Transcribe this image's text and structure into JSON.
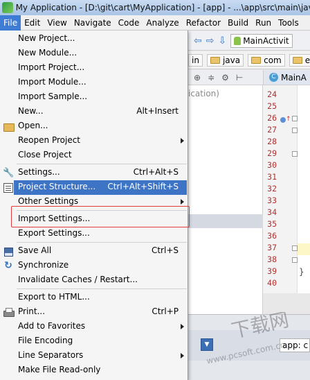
{
  "window": {
    "title": "My Application - [D:\\git\\cart\\MyApplication] - [app] - ...\\app\\src\\main\\java"
  },
  "menubar": {
    "items": [
      "File",
      "Edit",
      "View",
      "Navigate",
      "Code",
      "Analyze",
      "Refactor",
      "Build",
      "Run",
      "Tools"
    ]
  },
  "toolbar": {
    "run_config": "MainActivit"
  },
  "breadcrumbs": [
    "in",
    "java",
    "com",
    "exa"
  ],
  "project_pane": {
    "hint": "ication)"
  },
  "editor": {
    "tab_label": "MainA",
    "line_numbers": [
      "24",
      "25",
      "26",
      "27",
      "28",
      "29",
      "30",
      "31",
      "32",
      "33",
      "34",
      "35",
      "36",
      "37",
      "38",
      "39",
      "40"
    ]
  },
  "bottom": {
    "combo_value": "app: c"
  },
  "file_menu": {
    "items": [
      {
        "label": "New Project...",
        "shortcut": ""
      },
      {
        "label": "New Module...",
        "shortcut": ""
      },
      {
        "label": "Import Project...",
        "shortcut": ""
      },
      {
        "label": "Import Module...",
        "shortcut": ""
      },
      {
        "label": "Import Sample...",
        "shortcut": ""
      },
      {
        "label": "New...",
        "shortcut": "Alt+Insert"
      },
      {
        "label": "Open...",
        "shortcut": ""
      },
      {
        "label": "Reopen Project",
        "shortcut": ""
      },
      {
        "label": "Close Project",
        "shortcut": ""
      },
      {
        "label": "Settings...",
        "shortcut": "Ctrl+Alt+S"
      },
      {
        "label": "Project Structure...",
        "shortcut": "Ctrl+Alt+Shift+S"
      },
      {
        "label": "Other Settings",
        "shortcut": ""
      },
      {
        "label": "Import Settings...",
        "shortcut": ""
      },
      {
        "label": "Export Settings...",
        "shortcut": ""
      },
      {
        "label": "Save All",
        "shortcut": "Ctrl+S"
      },
      {
        "label": "Synchronize",
        "shortcut": ""
      },
      {
        "label": "Invalidate Caches / Restart...",
        "shortcut": ""
      },
      {
        "label": "Export to HTML...",
        "shortcut": ""
      },
      {
        "label": "Print...",
        "shortcut": "Ctrl+P"
      },
      {
        "label": "Add to Favorites",
        "shortcut": ""
      },
      {
        "label": "File Encoding",
        "shortcut": ""
      },
      {
        "label": "Line Separators",
        "shortcut": ""
      },
      {
        "label": "Make File Read-only",
        "shortcut": ""
      }
    ]
  },
  "watermark": {
    "text_cn": "下载网",
    "url": "www.pcsoft.com.cn"
  },
  "colors": {
    "highlight": "#3d74c5",
    "callout_border": "#e23b3b"
  }
}
